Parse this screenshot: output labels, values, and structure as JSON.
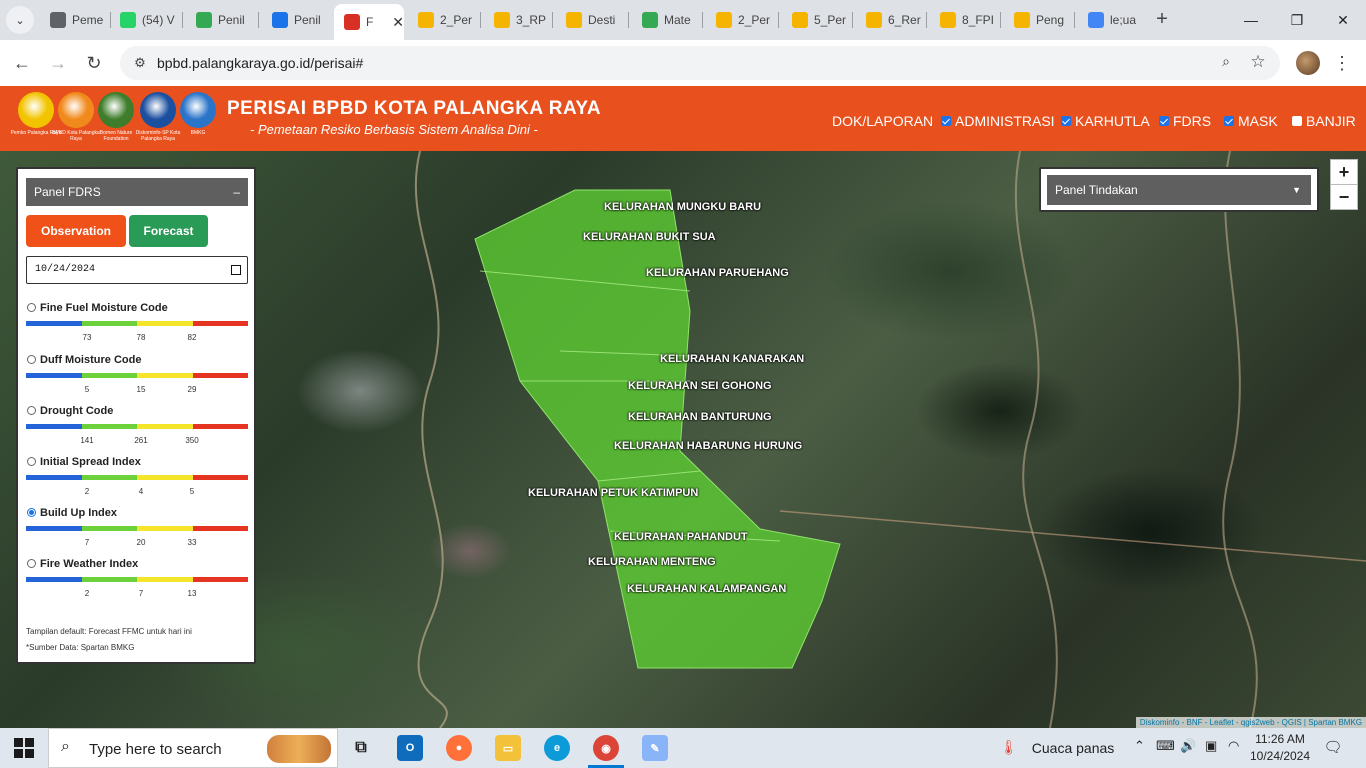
{
  "browser": {
    "tabs": [
      {
        "label": "Peme",
        "icon": "globe-icon",
        "color": "#5f6368"
      },
      {
        "label": "(54) V",
        "icon": "whatsapp-icon",
        "color": "#25d366"
      },
      {
        "label": "Penil",
        "icon": "asterisk-icon",
        "color": "#34a853"
      },
      {
        "label": "Penil",
        "icon": "edge-doc-icon",
        "color": "#1a73e8"
      },
      {
        "label": "F",
        "icon": "bpbd-icon",
        "color": "#d93025",
        "active": true
      },
      {
        "label": "2_Per",
        "icon": "folder-icon",
        "color": "#f4b400"
      },
      {
        "label": "3_RP",
        "icon": "folder-icon",
        "color": "#f4b400"
      },
      {
        "label": "Desti",
        "icon": "folder-icon",
        "color": "#f4b400"
      },
      {
        "label": "Mate",
        "icon": "drive-icon",
        "color": "#34a853"
      },
      {
        "label": "2_Per",
        "icon": "folder-icon",
        "color": "#f4b400"
      },
      {
        "label": "5_Per",
        "icon": "folder-icon",
        "color": "#f4b400"
      },
      {
        "label": "6_Rer",
        "icon": "folder-icon",
        "color": "#f4b400"
      },
      {
        "label": "8_FPI",
        "icon": "folder-icon",
        "color": "#f4b400"
      },
      {
        "label": "Peng",
        "icon": "folder-icon",
        "color": "#f4b400"
      },
      {
        "label": "le;ua",
        "icon": "google-icon",
        "color": "#4285f4"
      }
    ],
    "url": "bpbd.palangkaraya.go.id/perisai#"
  },
  "site": {
    "title": "PERISAI BPBD KOTA PALANGKA RAYA",
    "subtitle": "- Pemetaan Resiko Berbasis Sistem Analisa Dini -",
    "logos": [
      {
        "caption": "Pemko Palangka Raya",
        "color": "#f2c400"
      },
      {
        "caption": "BPBD Kota Palangka Raya",
        "color": "#f08a1c"
      },
      {
        "caption": "Borneo Nature Foundation",
        "color": "#3e7d2b"
      },
      {
        "caption": "Diskominfo-SP Kota Palangka Raya",
        "color": "#1b4fa0"
      },
      {
        "caption": "BMKG",
        "color": "#2a74c9"
      }
    ],
    "nav": {
      "dok": "DOK/LAPORAN",
      "administrasi": "ADMINISTRASI",
      "karhutla": "KARHUTLA",
      "fdrs": "FDRS",
      "mask": "MASK",
      "banjir": "BANJIR"
    }
  },
  "panel_fdrs": {
    "title": "Panel FDRS",
    "collapse": "–",
    "observation": "Observation",
    "forecast": "Forecast",
    "date": "10/24/2024",
    "indices": [
      {
        "name": "Fine Fuel Moisture Code",
        "ticks": [
          "73",
          "78",
          "82"
        ],
        "selected": false
      },
      {
        "name": "Duff Moisture Code",
        "ticks": [
          "5",
          "15",
          "29"
        ],
        "selected": false
      },
      {
        "name": "Drought Code",
        "ticks": [
          "141",
          "261",
          "350"
        ],
        "selected": false
      },
      {
        "name": "Initial Spread Index",
        "ticks": [
          "2",
          "4",
          "5"
        ],
        "selected": false
      },
      {
        "name": "Build Up Index",
        "ticks": [
          "7",
          "20",
          "33"
        ],
        "selected": true
      },
      {
        "name": "Fire Weather Index",
        "ticks": [
          "2",
          "7",
          "13"
        ],
        "selected": false
      }
    ],
    "scale_colors": [
      "#2563d9",
      "#6cd13a",
      "#f4e52a",
      "#e53422"
    ],
    "note": "Tampilan default: Forecast FFMC untuk hari ini",
    "source": "*Sumber Data: Spartan BMKG"
  },
  "panel_tindakan": {
    "title": "Panel Tindakan"
  },
  "map": {
    "zoom_in": "+",
    "zoom_out": "−",
    "attribution": "Diskominfo - BNF - Leaflet - qgis2web - QGIS | Spartan BMKG",
    "fill_color": "#5cc832",
    "kelurahan": [
      "KELURAHAN MUNGKU BARU",
      "KELURAHAN BUKIT SUA",
      "KELURAHAN PARUEHANG",
      "KELURAHAN KANARAKAN",
      "KELURAHAN SEI GOHONG",
      "KELURAHAN BANTURUNG",
      "KELURAHAN HABARUNG HURUNG",
      "KELURAHAN PETUK KATIMPUN",
      "KELURAHAN PAHANDUT",
      "KELURAHAN MENTENG",
      "KELURAHAN KALAMPANGAN"
    ]
  },
  "taskbar": {
    "search_placeholder": "Type here to search",
    "weather": "Cuaca panas",
    "time": "11:26 AM",
    "date": "10/24/2024"
  }
}
